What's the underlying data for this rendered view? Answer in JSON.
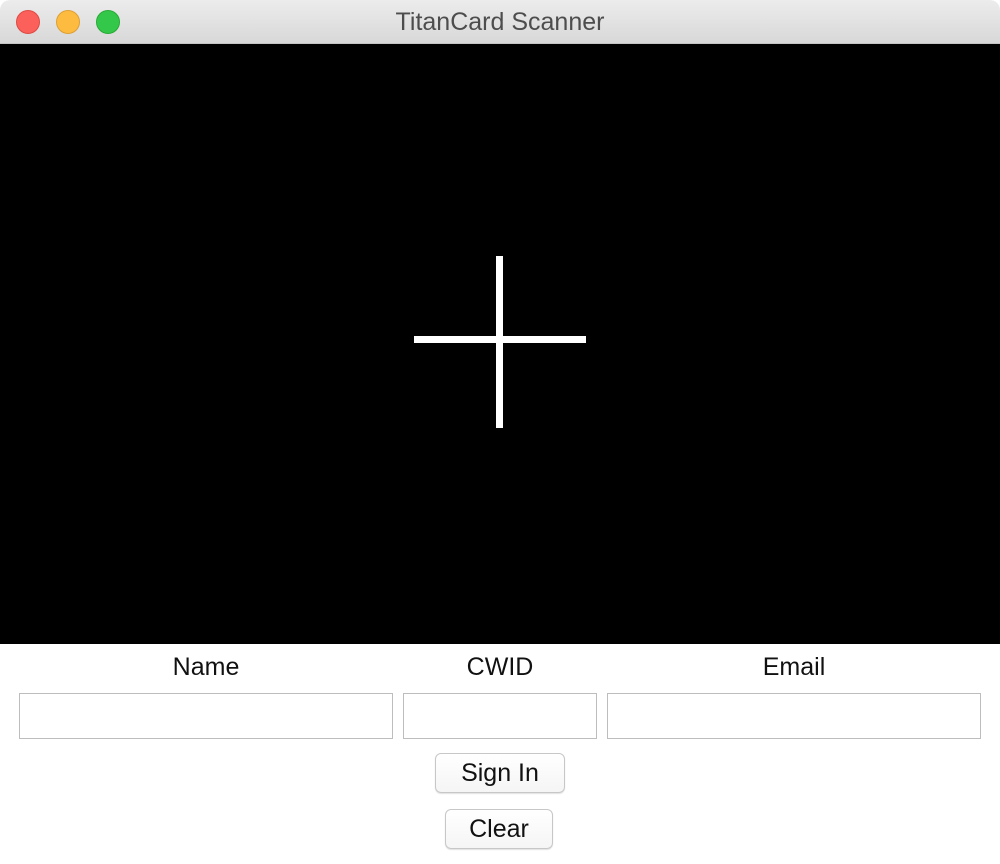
{
  "window": {
    "title": "TitanCard Scanner"
  },
  "camera": {
    "reticle_icon": "crosshair-icon",
    "background_color": "#000000",
    "reticle_color": "#ffffff"
  },
  "form": {
    "name_label": "Name",
    "cwid_label": "CWID",
    "email_label": "Email",
    "name_value": "",
    "cwid_value": "",
    "email_value": "",
    "name_placeholder": "",
    "cwid_placeholder": "",
    "email_placeholder": "",
    "sign_in_label": "Sign In",
    "clear_label": "Clear"
  },
  "colors": {
    "close": "#fc605b",
    "minimize": "#fdbc40",
    "zoom": "#34c84a"
  }
}
